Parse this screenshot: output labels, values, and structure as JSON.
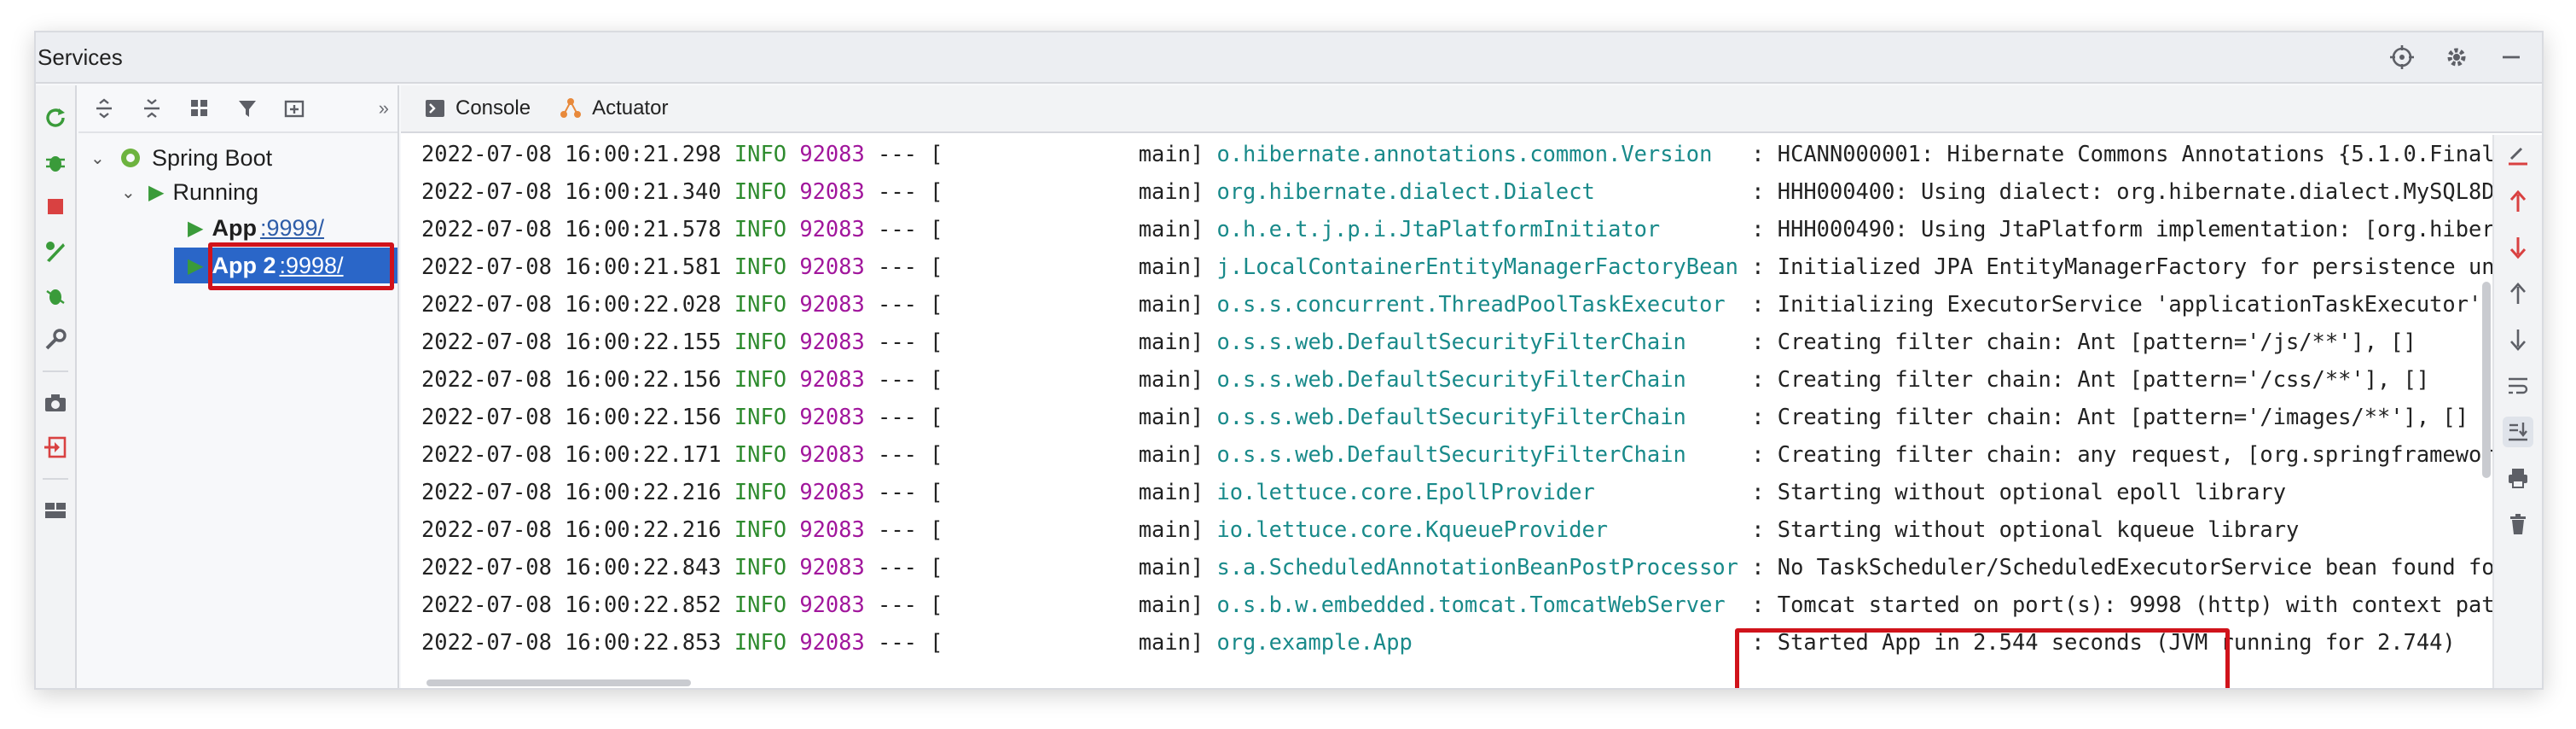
{
  "window": {
    "title": "Services"
  },
  "tree": {
    "root": "Spring Boot",
    "group": "Running",
    "apps": [
      {
        "name": "App",
        "port": ":9999/"
      },
      {
        "name": "App 2",
        "port": ":9998/"
      }
    ]
  },
  "tabs": [
    {
      "label": "Console"
    },
    {
      "label": "Actuator"
    }
  ],
  "console": {
    "lines": [
      {
        "ts": "2022-07-08 16:00:21.298",
        "level": "INFO",
        "pid": "92083",
        "sep": "--- [",
        "thread": "main]",
        "logger": "o.hibernate.annotations.common.Version",
        "msg": ": HCANN000001: Hibernate Commons Annotations {5.1.0.Final"
      },
      {
        "ts": "2022-07-08 16:00:21.340",
        "level": "INFO",
        "pid": "92083",
        "sep": "--- [",
        "thread": "main]",
        "logger": "org.hibernate.dialect.Dialect",
        "msg": ": HHH000400: Using dialect: org.hibernate.dialect.MySQL8D"
      },
      {
        "ts": "2022-07-08 16:00:21.578",
        "level": "INFO",
        "pid": "92083",
        "sep": "--- [",
        "thread": "main]",
        "logger": "o.h.e.t.j.p.i.JtaPlatformInitiator",
        "msg": ": HHH000490: Using JtaPlatform implementation: [org.hiber"
      },
      {
        "ts": "2022-07-08 16:00:21.581",
        "level": "INFO",
        "pid": "92083",
        "sep": "--- [",
        "thread": "main]",
        "logger": "j.LocalContainerEntityManagerFactoryBean",
        "msg": ": Initialized JPA EntityManagerFactory for persistence un"
      },
      {
        "ts": "2022-07-08 16:00:22.028",
        "level": "INFO",
        "pid": "92083",
        "sep": "--- [",
        "thread": "main]",
        "logger": "o.s.s.concurrent.ThreadPoolTaskExecutor",
        "msg": ": Initializing ExecutorService 'applicationTaskExecutor'"
      },
      {
        "ts": "2022-07-08 16:00:22.155",
        "level": "INFO",
        "pid": "92083",
        "sep": "--- [",
        "thread": "main]",
        "logger": "o.s.s.web.DefaultSecurityFilterChain",
        "msg": ": Creating filter chain: Ant [pattern='/js/**'], []"
      },
      {
        "ts": "2022-07-08 16:00:22.156",
        "level": "INFO",
        "pid": "92083",
        "sep": "--- [",
        "thread": "main]",
        "logger": "o.s.s.web.DefaultSecurityFilterChain",
        "msg": ": Creating filter chain: Ant [pattern='/css/**'], []"
      },
      {
        "ts": "2022-07-08 16:00:22.156",
        "level": "INFO",
        "pid": "92083",
        "sep": "--- [",
        "thread": "main]",
        "logger": "o.s.s.web.DefaultSecurityFilterChain",
        "msg": ": Creating filter chain: Ant [pattern='/images/**'], []"
      },
      {
        "ts": "2022-07-08 16:00:22.171",
        "level": "INFO",
        "pid": "92083",
        "sep": "--- [",
        "thread": "main]",
        "logger": "o.s.s.web.DefaultSecurityFilterChain",
        "msg": ": Creating filter chain: any request, [org.springframewor"
      },
      {
        "ts": "2022-07-08 16:00:22.216",
        "level": "INFO",
        "pid": "92083",
        "sep": "--- [",
        "thread": "main]",
        "logger": "io.lettuce.core.EpollProvider",
        "msg": ": Starting without optional epoll library"
      },
      {
        "ts": "2022-07-08 16:00:22.216",
        "level": "INFO",
        "pid": "92083",
        "sep": "--- [",
        "thread": "main]",
        "logger": "io.lettuce.core.KqueueProvider",
        "msg": ": Starting without optional kqueue library"
      },
      {
        "ts": "2022-07-08 16:00:22.843",
        "level": "INFO",
        "pid": "92083",
        "sep": "--- [",
        "thread": "main]",
        "logger": "s.a.ScheduledAnnotationBeanPostProcessor",
        "msg": ": No TaskScheduler/ScheduledExecutorService bean found fo"
      },
      {
        "ts": "2022-07-08 16:00:22.852",
        "level": "INFO",
        "pid": "92083",
        "sep": "--- [",
        "thread": "main]",
        "logger": "o.s.b.w.embedded.tomcat.TomcatWebServer",
        "msg": ": Tomcat started on port(s): 9998 (http) with context pat"
      },
      {
        "ts": "2022-07-08 16:00:22.853",
        "level": "INFO",
        "pid": "92083",
        "sep": "--- [",
        "thread": "main]",
        "logger": "org.example.App",
        "msg": ": Started App in 2.544 seconds (JVM running for 2.744)"
      }
    ]
  },
  "colors": {
    "accent": "#2a66c8",
    "highlight": "#d0131b",
    "level": "#2e8b2e",
    "pid": "#a1169c",
    "logger": "#198a8a"
  }
}
